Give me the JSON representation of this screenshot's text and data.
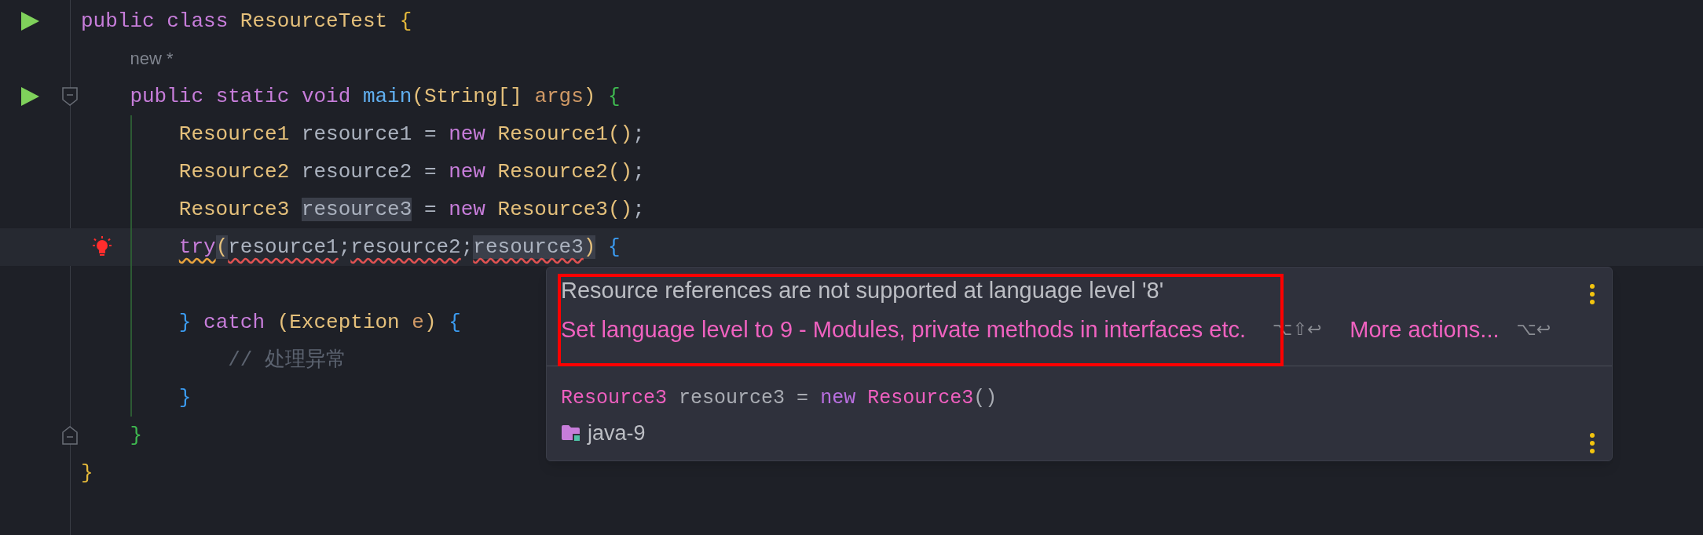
{
  "editor": {
    "lines": [
      {
        "run_button": true,
        "tokens": [
          {
            "text": "public",
            "kind": "kw"
          },
          {
            "text": "class",
            "kind": "kw",
            "spaced": true
          },
          {
            "text": "ResourceTest",
            "kind": "type",
            "spaced": true
          },
          {
            "text": "{",
            "kind": "outerbrace",
            "spaced": true
          }
        ],
        "children": [
          {
            "tokens": [
              {
                "text": "new *",
                "kind": "hint"
              }
            ]
          },
          {
            "run_button": true,
            "fold_open": true,
            "tokens": [
              {
                "text": "public",
                "kind": "kw"
              },
              {
                "text": "static",
                "kind": "kw",
                "spaced": true
              },
              {
                "text": "void",
                "kind": "kw",
                "spaced": true
              },
              {
                "text": "main",
                "kind": "fn",
                "spaced": true
              },
              {
                "text": "(",
                "kind": "paren"
              },
              {
                "text": "String[]",
                "kind": "type"
              },
              {
                "text": "args",
                "kind": "param",
                "spaced": true
              },
              {
                "text": ")",
                "kind": "paren"
              },
              {
                "text": "{",
                "kind": "methodbrace",
                "spaced": true
              }
            ],
            "children": [
              {
                "guide": true,
                "tokens": [
                  {
                    "text": "Resource1",
                    "kind": "type"
                  },
                  {
                    "text": "resource1",
                    "kind": "id",
                    "spaced": true
                  },
                  {
                    "text": "=",
                    "kind": "punct",
                    "spaced": true
                  },
                  {
                    "text": "new",
                    "kind": "kw",
                    "spaced": true
                  },
                  {
                    "text": "Resource1",
                    "kind": "type",
                    "spaced": true
                  },
                  {
                    "text": "()",
                    "kind": "paren"
                  },
                  {
                    "text": ";",
                    "kind": "punct"
                  }
                ]
              },
              {
                "guide": true,
                "tokens": [
                  {
                    "text": "Resource2",
                    "kind": "type"
                  },
                  {
                    "text": "resource2",
                    "kind": "id",
                    "spaced": true
                  },
                  {
                    "text": "=",
                    "kind": "punct",
                    "spaced": true
                  },
                  {
                    "text": "new",
                    "kind": "kw",
                    "spaced": true
                  },
                  {
                    "text": "Resource2",
                    "kind": "type",
                    "spaced": true
                  },
                  {
                    "text": "()",
                    "kind": "paren"
                  },
                  {
                    "text": ";",
                    "kind": "punct"
                  }
                ]
              },
              {
                "guide": true,
                "tokens": [
                  {
                    "text": "Resource3",
                    "kind": "type"
                  },
                  {
                    "text": "resource3",
                    "kind": "id",
                    "spaced": true,
                    "highlighted": true
                  },
                  {
                    "text": "=",
                    "kind": "punct",
                    "spaced": true
                  },
                  {
                    "text": "new",
                    "kind": "kw",
                    "spaced": true
                  },
                  {
                    "text": "Resource3",
                    "kind": "type",
                    "spaced": true
                  },
                  {
                    "text": "()",
                    "kind": "paren"
                  },
                  {
                    "text": ";",
                    "kind": "punct"
                  }
                ]
              },
              {
                "guide": true,
                "current": true,
                "bulb": true,
                "tokens": [
                  {
                    "text": "try",
                    "kind": "kw",
                    "warning": true
                  },
                  {
                    "text": "(",
                    "kind": "paren",
                    "highlighted": true
                  },
                  {
                    "text": "resource1",
                    "kind": "id",
                    "error": true
                  },
                  {
                    "text": ";",
                    "kind": "punct"
                  },
                  {
                    "text": "resource2",
                    "kind": "id",
                    "error": true
                  },
                  {
                    "text": ";",
                    "kind": "punct"
                  },
                  {
                    "text": "resource3",
                    "kind": "id",
                    "error": true,
                    "highlighted": true
                  },
                  {
                    "text": ")",
                    "kind": "paren",
                    "highlighted": true
                  },
                  {
                    "text": "{",
                    "kind": "innerbrace",
                    "spaced": true
                  }
                ],
                "children": [
                  {
                    "guide": true
                  }
                ]
              },
              {
                "guide": true,
                "tokens": [
                  {
                    "text": "}",
                    "kind": "innerbrace"
                  },
                  {
                    "text": "catch",
                    "kind": "kw",
                    "spaced": true
                  },
                  {
                    "text": "(",
                    "kind": "paren",
                    "spaced": true
                  },
                  {
                    "text": "Exception",
                    "kind": "type"
                  },
                  {
                    "text": "e",
                    "kind": "param",
                    "spaced": true
                  },
                  {
                    "text": ")",
                    "kind": "paren"
                  },
                  {
                    "text": "{",
                    "kind": "innerbrace",
                    "spaced": true
                  }
                ],
                "children": [
                  {
                    "guide": true,
                    "tokens": [
                      {
                        "text": "// 处理异常",
                        "kind": "comment"
                      }
                    ]
                  }
                ]
              },
              {
                "guide": true,
                "tokens": [
                  {
                    "text": "}",
                    "kind": "innerbrace"
                  }
                ]
              }
            ]
          },
          {
            "fold_close": true,
            "tokens": [
              {
                "text": "}",
                "kind": "methodbrace"
              }
            ]
          }
        ]
      },
      {
        "tokens": [
          {
            "text": "}",
            "kind": "outerbrace"
          }
        ]
      }
    ]
  },
  "popup": {
    "message": "Resource references are not supported at language level '8'",
    "fix": {
      "label": "Set language level to 9 - Modules, private methods in interfaces etc.",
      "shortcut": "⌥⇧↩"
    },
    "more_actions": {
      "label": "More actions...",
      "shortcut": "⌥↩"
    },
    "snippet": [
      {
        "text": "Resource3",
        "kind": "type"
      },
      {
        "text": "resource3",
        "kind": "id",
        "spaced": true
      },
      {
        "text": "=",
        "kind": "punct",
        "spaced": true
      },
      {
        "text": "new",
        "kind": "kw",
        "spaced": true
      },
      {
        "text": "Resource3",
        "kind": "type",
        "spaced": true
      },
      {
        "text": "()",
        "kind": "punct"
      }
    ],
    "module": "java-9"
  }
}
